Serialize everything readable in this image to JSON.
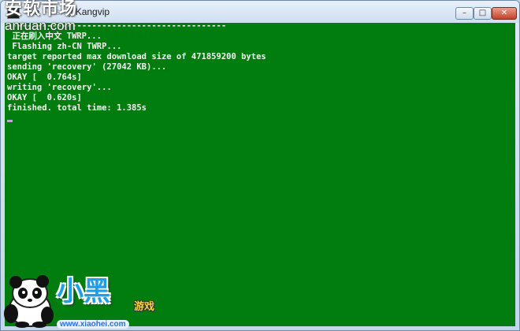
{
  "window": {
    "title_prefix": "Ne",
    "title_middle": " Flash ",
    "title_suffix": "y Kangvip",
    "buttons": {
      "minimize": "–",
      "maximize": "□",
      "close": "✕"
    }
  },
  "console": {
    "background": "#007d0e",
    "lines": [
      "--------------------------------------------",
      " 正在刷入中文 TWRP...",
      " Flashing zh-CN TWRP...",
      "target reported max download size of 471859200 bytes",
      "sending 'recovery' (27042 KB)...",
      "OKAY [  0.764s]",
      "writing 'recovery'...",
      "OKAY [  0.620s]",
      "finished. total time: 1.385s"
    ]
  },
  "watermark": {
    "title": "安软市场",
    "url": "anruan.com"
  },
  "branding": {
    "big_text": "小黑",
    "small_text": "游戏",
    "url": "www.xiaohei.com"
  }
}
